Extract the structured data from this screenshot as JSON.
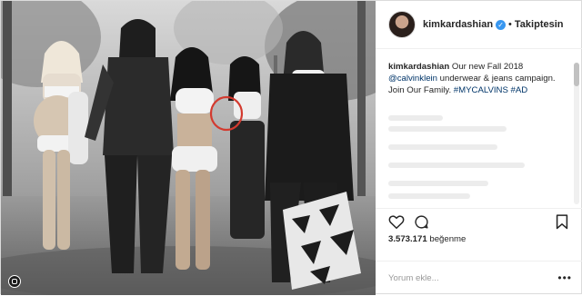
{
  "post": {
    "username": "kimkardashian",
    "verified_badge": "✓",
    "separator": "•",
    "follow_label": "Takiptesin",
    "caption": {
      "username": "kimkardashian",
      "part1": "Our new Fall 2018",
      "mention": "@calvinklein",
      "part2": "underwear & jeans campaign. Join Our Family.",
      "hashtag1": "#MYCALVINS",
      "hashtag2": "#AD"
    },
    "likes": {
      "count": "3.573.171",
      "label": "beğenme"
    },
    "comment_placeholder": "Yorum ekle...",
    "more_label": "•••"
  },
  "colors": {
    "link": "#003569",
    "verified": "#3897f0",
    "highlight_circle": "#d33a2f"
  },
  "icons": [
    "heart-icon",
    "comment-icon",
    "bookmark-icon",
    "more-options-icon",
    "verified-icon",
    "instagram-icon"
  ]
}
